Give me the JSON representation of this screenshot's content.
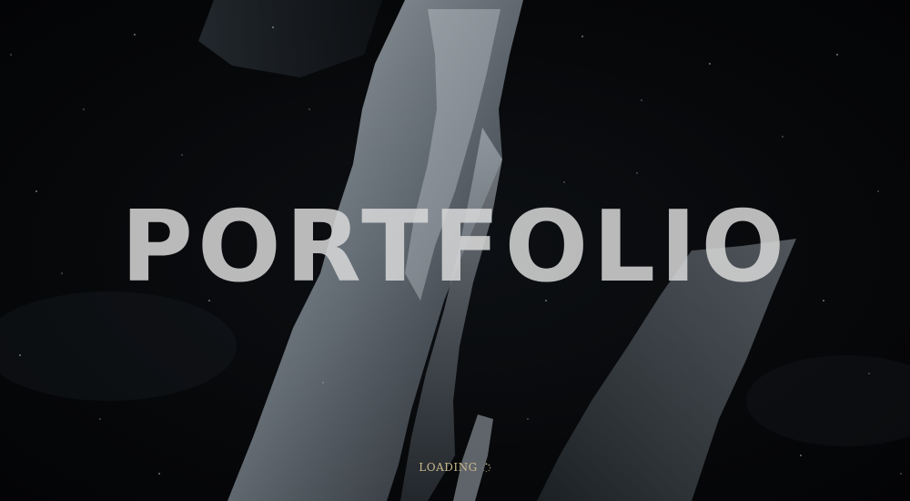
{
  "hero": {
    "title": "PORTFOLIO"
  },
  "loader": {
    "label": "LOADING",
    "icon": "spinner-icon",
    "color": "#c9b98d"
  },
  "background": {
    "icon": "brush-stroke-artwork",
    "base_color": "#050608",
    "stroke_color": "#9aa3ab"
  }
}
